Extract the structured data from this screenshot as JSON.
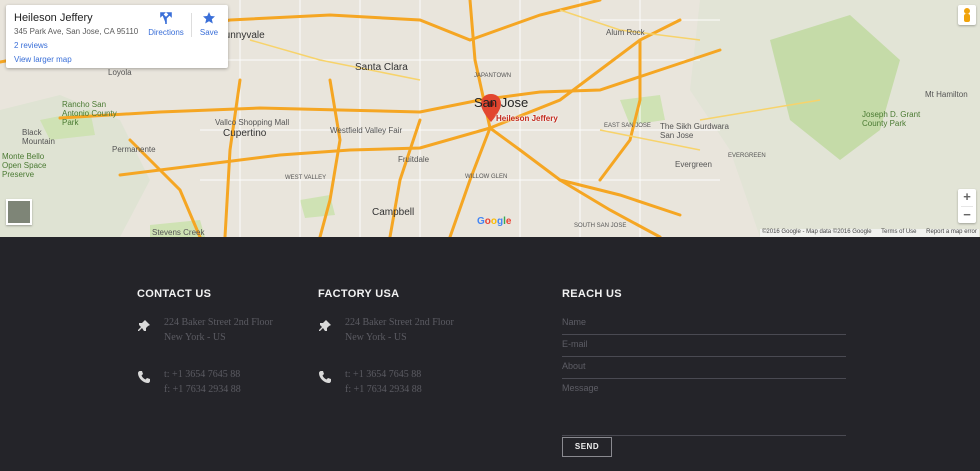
{
  "map": {
    "infocard": {
      "place_name": "Heileson Jeffery",
      "address": "345 Park Ave, San Jose, CA 95110",
      "reviews": "2 reviews",
      "view_larger": "View larger map",
      "directions_label": "Directions",
      "save_label": "Save"
    },
    "pin_label": "Heileson Jeffery",
    "zoom_in": "+",
    "zoom_out": "−",
    "attribution": {
      "copyright": "©2016 Google - Map data ©2016 Google",
      "terms": "Terms of Use",
      "report": "Report a map error"
    },
    "labels": {
      "san_jose": "San Jose",
      "santa_clara": "Santa Clara",
      "sunnyvale": "Sunnyvale",
      "cupertino": "Cupertino",
      "campbell": "Campbell",
      "loyola": "Loyola",
      "permanente": "Permanente",
      "fruitdale": "Fruitdale",
      "evergreen": "Evergreen",
      "alum_rock": "Alum Rock",
      "mt_hamilton": "Mt Hamilton",
      "the_sikh_gurdwara": "The Sikh Gurdwara San Jose",
      "joseph_grant": "Joseph D. Grant County Park",
      "vallco": "Vallco Shopping Mall",
      "westfield": "Westfield Valley Fair",
      "rancho_san_antonio": "Rancho San Antonio County Park",
      "black_mountain": "Black Mountain",
      "monte_bello": "Monte Bello Open Space Preserve",
      "stevens_creek": "Stevens Creek",
      "japantown": "JAPANTOWN",
      "east_san_jose": "EAST SAN JOSE",
      "willow_glen": "WILLOW GLEN",
      "west_valley": "WEST VALLEY",
      "evergreen_area": "EVERGREEN",
      "south_san_jose": "SOUTH SAN JOSE"
    },
    "colors": {
      "highway": "#f5a623",
      "pin": "#e2462f",
      "park": "#c5dba8",
      "land": "#e9e5dc"
    }
  },
  "footer": {
    "contact": {
      "title": "CONTACT US",
      "address_line1": "224 Baker Street 2nd Floor",
      "address_line2": "New York - US",
      "phone": "t: +1 3654 7645 88",
      "fax": "f: +1 7634 2934 88"
    },
    "factory": {
      "title": "FACTORY USA",
      "address_line1": "224 Baker Street 2nd Floor",
      "address_line2": "New York - US",
      "phone": "t: +1 3654 7645 88",
      "fax": "f: +1 7634 2934 88"
    },
    "reach": {
      "title": "REACH US",
      "name_placeholder": "Name",
      "email_placeholder": "E-mail",
      "about_placeholder": "About",
      "message_placeholder": "Message",
      "send_label": "SEND"
    }
  }
}
